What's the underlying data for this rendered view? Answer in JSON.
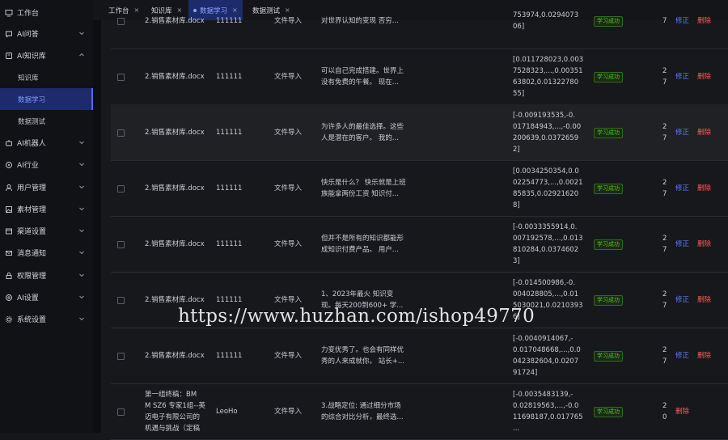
{
  "sidebar": {
    "items": [
      {
        "label": "工作台",
        "icon": "monitor-icon",
        "has_chevron": false,
        "sub": false
      },
      {
        "label": "AI问答",
        "icon": "chat-icon",
        "has_chevron": true,
        "sub": false
      },
      {
        "label": "AI知识库",
        "icon": "book-icon",
        "has_chevron": true,
        "sub": false,
        "expanded": true
      },
      {
        "label": "知识库",
        "sub": true
      },
      {
        "label": "数据学习",
        "sub": true,
        "active": true
      },
      {
        "label": "数据测试",
        "sub": true
      },
      {
        "label": "AI机器人",
        "icon": "robot-icon",
        "has_chevron": true,
        "sub": false
      },
      {
        "label": "AI行业",
        "icon": "industry-icon",
        "has_chevron": true,
        "sub": false
      },
      {
        "label": "用户管理",
        "icon": "user-icon",
        "has_chevron": true,
        "sub": false
      },
      {
        "label": "素材管理",
        "icon": "image-icon",
        "has_chevron": true,
        "sub": false
      },
      {
        "label": "渠道设置",
        "icon": "channel-icon",
        "has_chevron": true,
        "sub": false
      },
      {
        "label": "消息通知",
        "icon": "mail-icon",
        "has_chevron": true,
        "sub": false
      },
      {
        "label": "权限管理",
        "icon": "shield-icon",
        "has_chevron": true,
        "sub": false
      },
      {
        "label": "AI设置",
        "icon": "ai-settings-icon",
        "has_chevron": true,
        "sub": false
      },
      {
        "label": "系统设置",
        "icon": "gear-icon",
        "has_chevron": true,
        "sub": false
      }
    ]
  },
  "tabs": [
    {
      "label": "工作台",
      "close": "×",
      "active": false
    },
    {
      "label": "知识库",
      "close": "×",
      "active": false
    },
    {
      "label": "数据学习",
      "close": "×",
      "active": true
    },
    {
      "label": "数据测试",
      "close": "×",
      "active": false
    }
  ],
  "status_color": "#53c41a",
  "accent_color": "#5b7cff",
  "danger_color": "#ff5a5a",
  "rows": [
    {
      "file": "2.销售素材库.docx",
      "code": "111111",
      "source": "文件导入",
      "text": [
        "对世界认知的变现 否穷..."
      ],
      "vector": [
        "753974,0.0294073",
        "06]"
      ],
      "status": "学习成功",
      "num": "7",
      "edit": "修正",
      "del": "删除",
      "highlight": false
    },
    {
      "file": "2.销售素材库.docx",
      "code": "111111",
      "source": "文件导入",
      "text": [
        "可以自己完成搭建。世界上",
        "没有免费的午餐。 现在..."
      ],
      "vector": [
        "[0.011728023,0.003",
        "7528323,...,0.00351",
        "63802,0.01322780",
        "55]"
      ],
      "status": "学习成功",
      "num": "2",
      "num2": "7",
      "edit": "修正",
      "del": "删除",
      "highlight": false
    },
    {
      "file": "2.销售素材库.docx",
      "code": "111111",
      "source": "文件导入",
      "text": [
        "为许多人的最佳选择。这些",
        "人是潜在的客户。 我的..."
      ],
      "vector": [
        "[-0.009193535,-0.",
        "017184943,...,-0.00",
        "200639,0.0372659",
        "2]"
      ],
      "status": "学习成功",
      "num": "2",
      "num2": "7",
      "edit": "修正",
      "del": "删除",
      "highlight": true
    },
    {
      "file": "2.销售素材库.docx",
      "code": "111111",
      "source": "文件导入",
      "text": [
        "快乐是什么？ 快乐就是上班",
        "族能拿两份工资 知识付..."
      ],
      "vector": [
        "[0.0034250354,0.0",
        "02254773,...,0.0021",
        "85835,0.02921620",
        "8]"
      ],
      "status": "学习成功",
      "num": "2",
      "num2": "7",
      "edit": "修正",
      "del": "删除",
      "highlight": false
    },
    {
      "file": "2.销售素材库.docx",
      "code": "111111",
      "source": "文件导入",
      "text": [
        "但并不是所有的知识都能形",
        "成知识付费产品。 用户..."
      ],
      "vector": [
        "[-0.0033355914,0.",
        "007192578,...,0.013",
        "810284,0.0374602",
        "3]"
      ],
      "status": "学习成功",
      "num": "2",
      "num2": "7",
      "edit": "修正",
      "del": "删除",
      "highlight": false
    },
    {
      "file": "2.销售素材库.docx",
      "code": "111111",
      "source": "文件导入",
      "text": [
        "1、2023年最火 知识变",
        "现。每天200到600+ 学..."
      ],
      "vector": [
        "[-0.014500986,-0.",
        "004028805,...,0.01",
        "5030021,0.0210393",
        "6]"
      ],
      "status": "学习成功",
      "num": "2",
      "num2": "7",
      "edit": "修正",
      "del": "删除",
      "highlight": false
    },
    {
      "file": "2.销售素材库.docx",
      "code": "111111",
      "source": "文件导入",
      "text": [
        "力变优秀了。也会有同样优",
        "秀的人来成就你。 站长+..."
      ],
      "vector": [
        "[-0.0040914067,-",
        "0.017048668,...,0.0",
        "042382604,0.0207",
        "91724]"
      ],
      "status": "学习成功",
      "num": "2",
      "num2": "7",
      "edit": "修正",
      "del": "删除",
      "highlight": false
    },
    {
      "file_lines": [
        "第一组终稿：BM",
        "M SZ6 专家1组--英",
        "迈电子有限公司的",
        "机遇与挑战（定稿"
      ],
      "code": "LeoHo",
      "source": "文件导入",
      "text": [
        "3.战略定位: 通过细分市场",
        "的综合对比分析，最终选..."
      ],
      "vector": [
        "[-0.0035483139,-",
        "0.02819563,...,-0.0",
        "11698187,0.017765",
        "..."
      ],
      "status": "学习成功",
      "num": "2",
      "num2": "0",
      "edit": "",
      "del": "删除",
      "highlight": false
    }
  ],
  "watermark": "https://www.huzhan.com/ishop49770"
}
